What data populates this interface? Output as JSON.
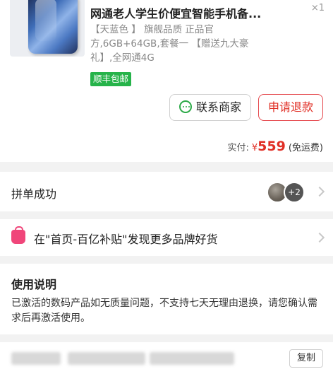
{
  "product": {
    "title": "网通老人学生价便宜智能手机备...",
    "qty": "×1",
    "spec_lines": [
      "【天蓝色 】 旗舰品质 正品官",
      "方,6GB+64GB,套餐一 【赠送九大豪",
      "礼】,全网通4G"
    ],
    "shipping_tag": "顺丰包邮",
    "color_tag": "#26b34a"
  },
  "actions": {
    "contact": "联系商家",
    "refund": "申请退款"
  },
  "payment": {
    "label": "实付:",
    "currency": "¥",
    "amount": "559",
    "note": "(免运费)",
    "accent": "#e02e24"
  },
  "group": {
    "label": "拼单成功",
    "extra_count": "+2"
  },
  "promo": {
    "text": "在\"首页-百亿补贴\"发现更多品牌好货"
  },
  "usage": {
    "title": "使用说明",
    "text": "已激活的数码产品如无质量问题，不支持七天无理由退换，请您确认需求后再激活使用。"
  },
  "bottom": {
    "copy": "复制"
  }
}
